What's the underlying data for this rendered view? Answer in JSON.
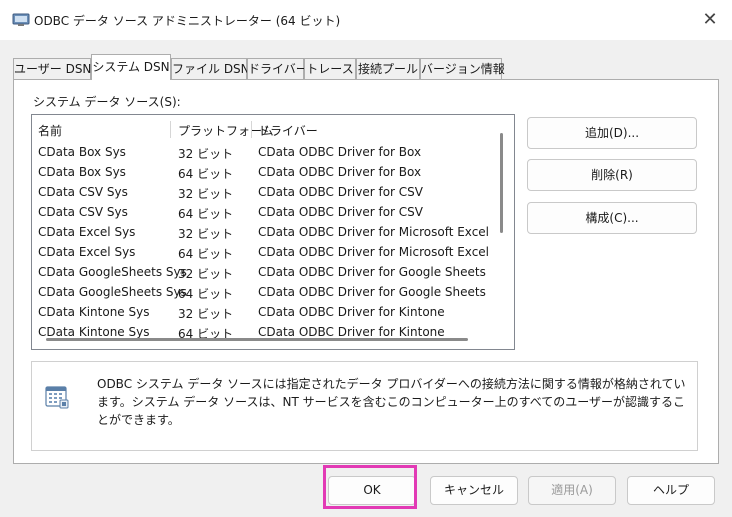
{
  "window": {
    "title": "ODBC データ ソース アドミニストレーター (64 ビット)",
    "close_glyph": "✕"
  },
  "tabs": [
    {
      "label": "ユーザー DSN"
    },
    {
      "label": "システム DSN",
      "active": true
    },
    {
      "label": "ファイル DSN"
    },
    {
      "label": "ドライバー"
    },
    {
      "label": "トレース"
    },
    {
      "label": "接続プール"
    },
    {
      "label": "バージョン情報"
    }
  ],
  "list": {
    "label": "システム データ ソース(S):",
    "columns": [
      "名前",
      "プラットフォーム",
      "ドライバー"
    ],
    "rows": [
      [
        "CData Box Sys",
        "32 ビット",
        "CData ODBC Driver for Box"
      ],
      [
        "CData Box Sys",
        "64 ビット",
        "CData ODBC Driver for Box"
      ],
      [
        "CData CSV Sys",
        "32 ビット",
        "CData ODBC Driver for CSV"
      ],
      [
        "CData CSV Sys",
        "64 ビット",
        "CData ODBC Driver for CSV"
      ],
      [
        "CData Excel Sys",
        "32 ビット",
        "CData ODBC Driver for Microsoft Excel"
      ],
      [
        "CData Excel Sys",
        "64 ビット",
        "CData ODBC Driver for Microsoft Excel"
      ],
      [
        "CData GoogleSheets Sys",
        "32 ビット",
        "CData ODBC Driver for Google Sheets"
      ],
      [
        "CData GoogleSheets Sys",
        "64 ビット",
        "CData ODBC Driver for Google Sheets"
      ],
      [
        "CData Kintone Sys",
        "32 ビット",
        "CData ODBC Driver for Kintone"
      ],
      [
        "CData Kintone Sys",
        "64 ビット",
        "CData ODBC Driver for Kintone"
      ]
    ]
  },
  "side_buttons": {
    "add": "追加(D)...",
    "remove": "削除(R)",
    "configure": "構成(C)..."
  },
  "info_text": "ODBC システム データ ソースには指定されたデータ プロバイダーへの接続方法に関する情報が格納されています。システム データ ソースは、NT サービスを含むこのコンピューター上のすべてのユーザーが認識することができます。",
  "bottom_buttons": {
    "ok": "OK",
    "cancel": "キャンセル",
    "apply": "適用(A)",
    "help": "ヘルプ"
  },
  "colors": {
    "highlight": "#e23ab5"
  }
}
